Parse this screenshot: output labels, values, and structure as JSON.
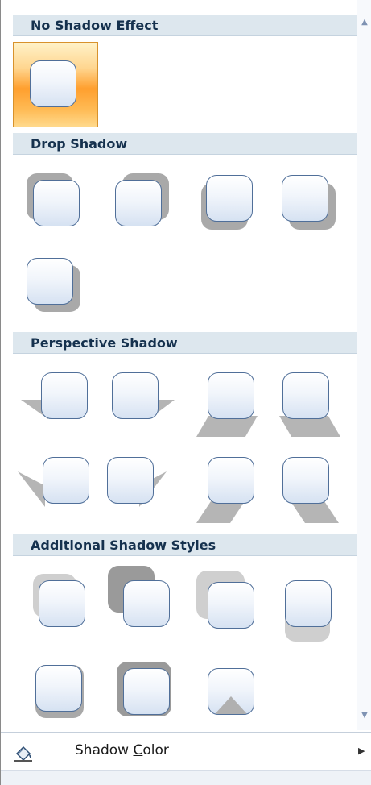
{
  "sections": {
    "no_shadow": "No Shadow Effect",
    "drop": "Drop Shadow",
    "perspective": "Perspective Shadow",
    "additional": "Additional Shadow Styles"
  },
  "footer": {
    "label": "Shadow Color",
    "icon": "paint-bucket-icon",
    "submenu": "chevron-right-icon"
  },
  "colors": {
    "header_bg": "#dde7ee",
    "selected_orange": "#ff9f2e",
    "shape_border": "#506f99"
  },
  "selected_option": "No Shadow Effect"
}
